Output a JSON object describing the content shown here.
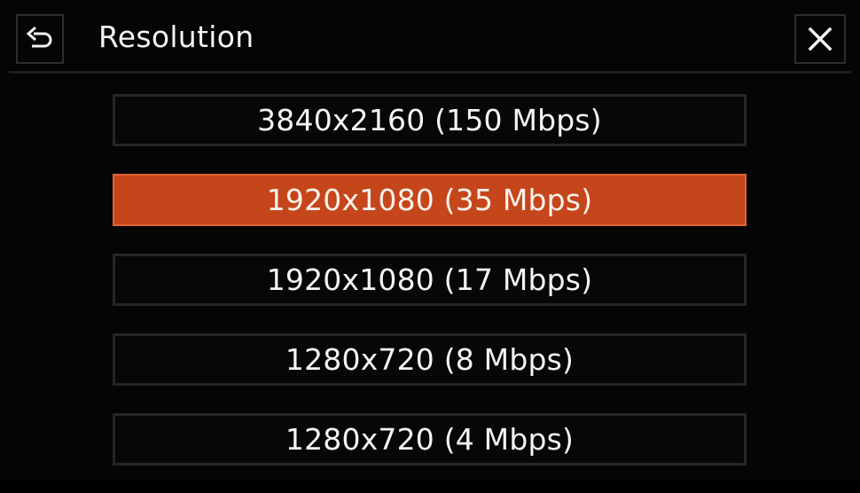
{
  "header": {
    "title": "Resolution",
    "back_icon": "return-arrow-icon",
    "close_icon": "close-x-icon"
  },
  "colors": {
    "background": "#050505",
    "selected": "#c5461a",
    "border": "#262626"
  },
  "options": [
    {
      "label": "3840x2160 (150 Mbps)",
      "selected": false
    },
    {
      "label": "1920x1080 (35 Mbps)",
      "selected": true
    },
    {
      "label": "1920x1080 (17 Mbps)",
      "selected": false
    },
    {
      "label": "1280x720 (8 Mbps)",
      "selected": false
    },
    {
      "label": "1280x720 (4 Mbps)",
      "selected": false
    }
  ]
}
